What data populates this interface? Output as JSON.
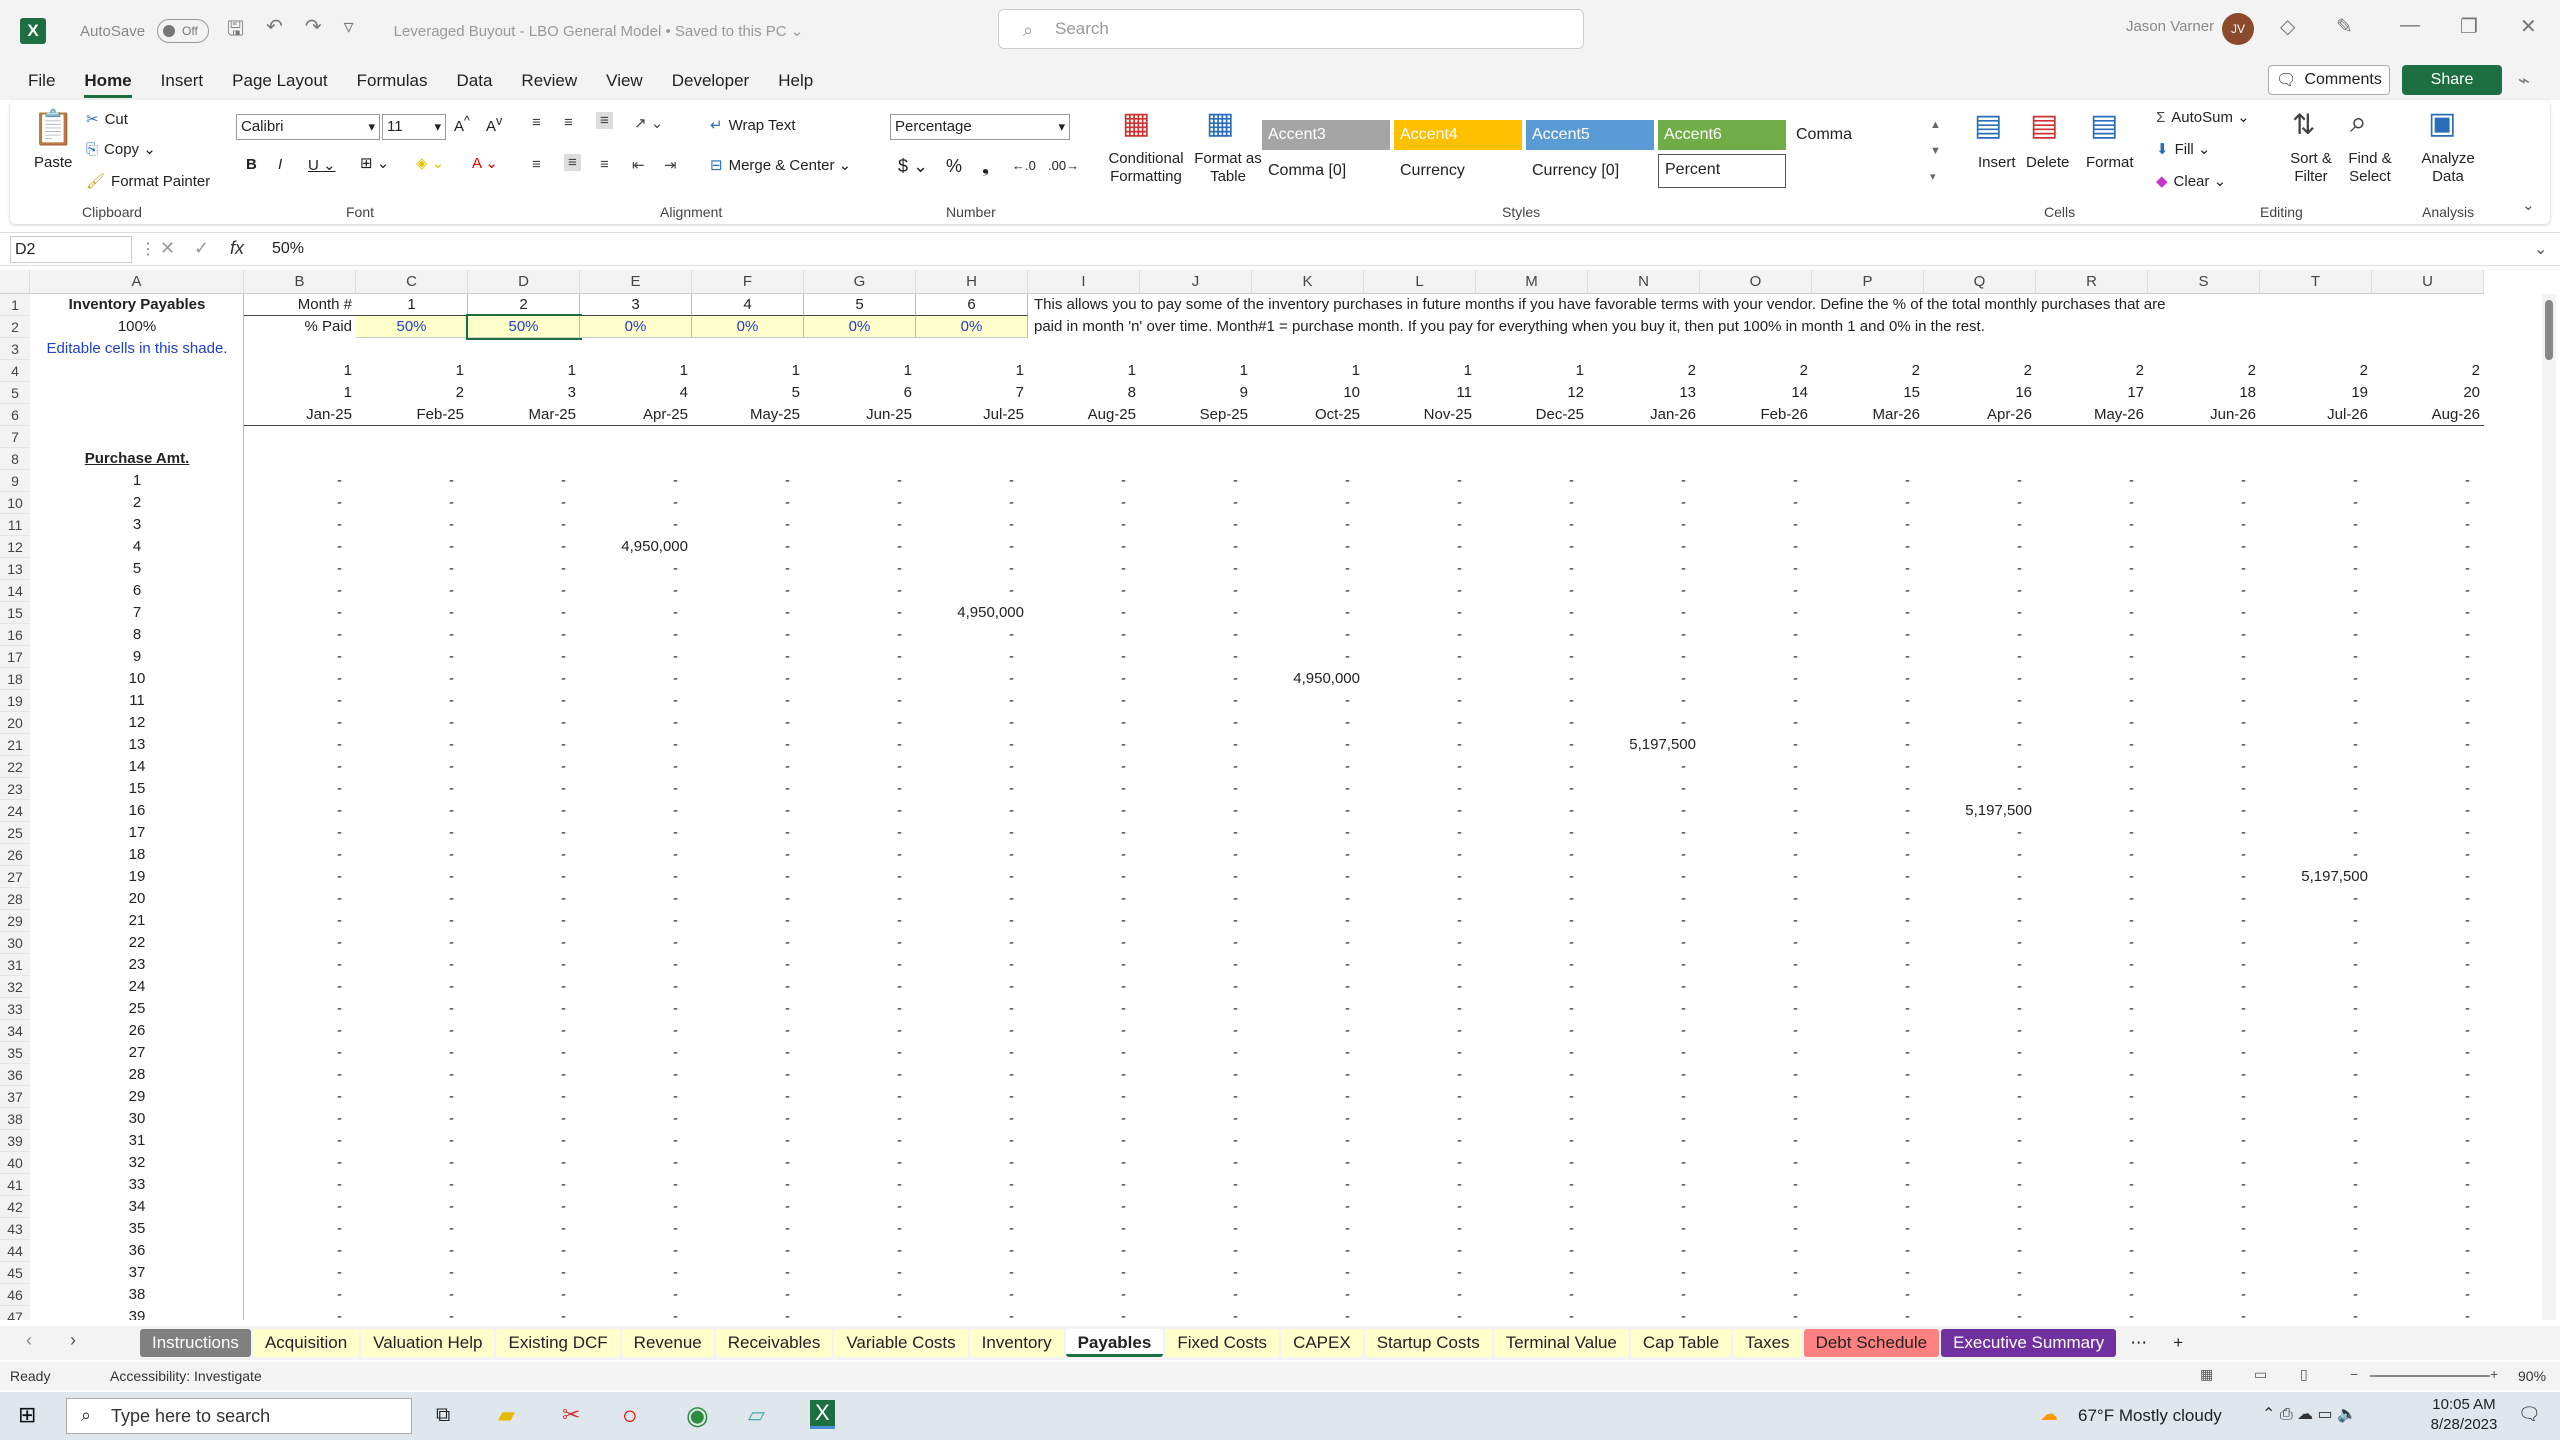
{
  "title_bar": {
    "app_logo": "X",
    "autosave_label": "AutoSave",
    "autosave_state": "Off",
    "document_title": "Leveraged Buyout - LBO General Model • Saved to this PC ⌄",
    "search_placeholder": "Search",
    "user_name": "Jason Varner",
    "user_initials": "JV"
  },
  "menu": {
    "items": [
      "File",
      "Home",
      "Insert",
      "Page Layout",
      "Formulas",
      "Data",
      "Review",
      "View",
      "Developer",
      "Help"
    ],
    "active": "Home",
    "comments_label": "Comments",
    "share_label": "Share"
  },
  "ribbon": {
    "clipboard": {
      "paste": "Paste",
      "cut": "Cut",
      "copy": "Copy",
      "format_painter": "Format Painter",
      "label": "Clipboard"
    },
    "font": {
      "family": "Calibri",
      "size": "11",
      "label": "Font"
    },
    "alignment": {
      "wrap_text": "Wrap Text",
      "merge_center": "Merge & Center",
      "label": "Alignment"
    },
    "number": {
      "format": "Percentage",
      "label": "Number"
    },
    "styles": {
      "conditional": "Conditional Formatting",
      "format_table": "Format as Table",
      "boxes": [
        {
          "name": "Accent3",
          "bg": "#a5a5a5",
          "fg": "#ffffff"
        },
        {
          "name": "Accent4",
          "bg": "#ffc000",
          "fg": "#ffffff"
        },
        {
          "name": "Accent5",
          "bg": "#5b9bd5",
          "fg": "#ffffff"
        },
        {
          "name": "Accent6",
          "bg": "#70ad47",
          "fg": "#ffffff"
        },
        {
          "name": "Comma",
          "bg": "#ffffff",
          "fg": "#222222"
        },
        {
          "name": "Comma [0]",
          "bg": "#ffffff",
          "fg": "#222222"
        },
        {
          "name": "Currency",
          "bg": "#ffffff",
          "fg": "#222222"
        },
        {
          "name": "Currency [0]",
          "bg": "#ffffff",
          "fg": "#222222"
        },
        {
          "name": "Percent",
          "bg": "#ffffff",
          "fg": "#222222"
        }
      ],
      "label": "Styles"
    },
    "cells": {
      "insert": "Insert",
      "delete": "Delete",
      "format": "Format",
      "label": "Cells"
    },
    "editing": {
      "autosum": "AutoSum",
      "fill": "Fill",
      "clear": "Clear",
      "sort_filter": "Sort & Filter",
      "find_select": "Find & Select",
      "label": "Editing"
    },
    "analysis": {
      "analyze": "Analyze Data",
      "label": "Analysis"
    }
  },
  "formula_bar": {
    "name_box": "D2",
    "fx": "fx",
    "value": "50%"
  },
  "grid": {
    "columns": [
      "A",
      "B",
      "C",
      "D",
      "E",
      "F",
      "G",
      "H",
      "I",
      "J",
      "K",
      "L",
      "M",
      "N",
      "O",
      "P",
      "Q",
      "R",
      "S",
      "T",
      "U"
    ],
    "header_a1": "Inventory Payables",
    "a2": "100%",
    "a3": "Editable cells in this shade.",
    "b1": "Month #",
    "b2": "% Paid",
    "month_numbers": [
      "1",
      "2",
      "3",
      "4",
      "5",
      "6"
    ],
    "paid_pcts": [
      "50%",
      "50%",
      "0%",
      "0%",
      "0%",
      "0%"
    ],
    "note_line1": "This allows you to pay some of the inventory purchases in future months if you have favorable terms with your vendor. Define the % of the total monthly purchases that are",
    "note_line2": "paid in month 'n' over time. Month#1 = purchase month. If you pay for everything when you buy it, then put 100% in month 1 and 0% in the rest.",
    "row4": [
      "1",
      "1",
      "1",
      "1",
      "1",
      "1",
      "1",
      "1",
      "1",
      "1",
      "1",
      "1",
      "2",
      "2",
      "2",
      "2",
      "2",
      "2",
      "2",
      "2"
    ],
    "row5": [
      "1",
      "2",
      "3",
      "4",
      "5",
      "6",
      "7",
      "8",
      "9",
      "10",
      "11",
      "12",
      "13",
      "14",
      "15",
      "16",
      "17",
      "18",
      "19",
      "20"
    ],
    "row6": [
      "Jan-25",
      "Feb-25",
      "Mar-25",
      "Apr-25",
      "May-25",
      "Jun-25",
      "Jul-25",
      "Aug-25",
      "Sep-25",
      "Oct-25",
      "Nov-25",
      "Dec-25",
      "Jan-26",
      "Feb-26",
      "Mar-26",
      "Apr-26",
      "May-26",
      "Jun-26",
      "Jul-26",
      "Aug-26"
    ],
    "purchase_label": "Purchase Amt.",
    "purchase_values": [
      {
        "row": 12,
        "col": "E",
        "value": "4,950,000"
      },
      {
        "row": 15,
        "col": "H",
        "value": "4,950,000"
      },
      {
        "row": 18,
        "col": "K",
        "value": "4,950,000"
      },
      {
        "row": 21,
        "col": "N",
        "value": "5,197,500"
      },
      {
        "row": 24,
        "col": "Q",
        "value": "5,197,500"
      },
      {
        "row": 27,
        "col": "T",
        "value": "5,197,500"
      }
    ],
    "dash": "-"
  },
  "sheet_tabs": [
    {
      "name": "Instructions",
      "bg": "#808080",
      "fg": "#ffffff"
    },
    {
      "name": "Acquisition",
      "bg": "#ffffcc",
      "fg": "#222222"
    },
    {
      "name": "Valuation Help",
      "bg": "#ffffcc",
      "fg": "#222222"
    },
    {
      "name": "Existing DCF",
      "bg": "#ffffcc",
      "fg": "#222222"
    },
    {
      "name": "Revenue",
      "bg": "#ffffcc",
      "fg": "#222222"
    },
    {
      "name": "Receivables",
      "bg": "#ffffcc",
      "fg": "#222222"
    },
    {
      "name": "Variable Costs",
      "bg": "#ffffcc",
      "fg": "#222222"
    },
    {
      "name": "Inventory",
      "bg": "#ffffcc",
      "fg": "#222222"
    },
    {
      "name": "Payables",
      "bg": "#ffffff",
      "fg": "#222222",
      "active": true
    },
    {
      "name": "Fixed Costs",
      "bg": "#ffffcc",
      "fg": "#222222"
    },
    {
      "name": "CAPEX",
      "bg": "#ffffcc",
      "fg": "#222222"
    },
    {
      "name": "Startup Costs",
      "bg": "#ffffcc",
      "fg": "#222222"
    },
    {
      "name": "Terminal Value",
      "bg": "#ffffcc",
      "fg": "#222222"
    },
    {
      "name": "Cap Table",
      "bg": "#ffffcc",
      "fg": "#222222"
    },
    {
      "name": "Taxes",
      "bg": "#ffffcc",
      "fg": "#222222"
    },
    {
      "name": "Debt Schedule",
      "bg": "#ff8080",
      "fg": "#222222"
    },
    {
      "name": "Executive Summary",
      "bg": "#7030a0",
      "fg": "#ffffff"
    }
  ],
  "status": {
    "ready": "Ready",
    "accessibility": "Accessibility: Investigate",
    "zoom": "90%"
  },
  "taskbar": {
    "search_placeholder": "Type here to search",
    "weather": "67°F  Mostly cloudy",
    "time": "10:05 AM",
    "date": "8/28/2023"
  }
}
